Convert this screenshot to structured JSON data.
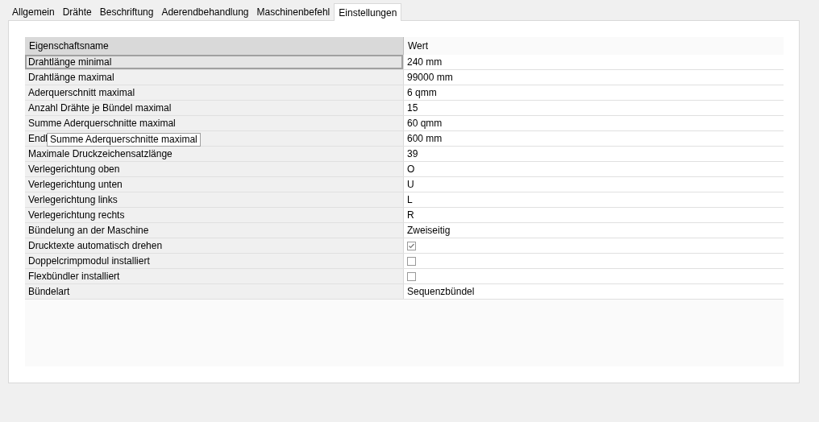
{
  "tabs": [
    {
      "label": "Allgemein",
      "selected": false
    },
    {
      "label": "Drähte",
      "selected": false
    },
    {
      "label": "Beschriftung",
      "selected": false
    },
    {
      "label": "Aderendbehandlung",
      "selected": false
    },
    {
      "label": "Maschinenbefehl",
      "selected": false
    },
    {
      "label": "Einstellungen",
      "selected": true
    }
  ],
  "grid": {
    "columns": [
      "Eigenschaftsname",
      "Wert"
    ],
    "rows": [
      {
        "name": "Drahtlänge minimal",
        "kind": "text",
        "value": "240 mm",
        "selected": true
      },
      {
        "name": "Drahtlänge maximal",
        "kind": "text",
        "value": "99000 mm",
        "selected": false
      },
      {
        "name": "Aderquerschnitt maximal",
        "kind": "text",
        "value": "6 qmm",
        "selected": false
      },
      {
        "name": "Anzahl Drähte je Bündel maximal",
        "kind": "text",
        "value": "15",
        "selected": false
      },
      {
        "name": "Summe Aderquerschnitte maximal",
        "kind": "text",
        "value": "60 qmm",
        "selected": false
      },
      {
        "name": "Endl",
        "kind": "text",
        "value": "600 mm",
        "selected": false
      },
      {
        "name": "Maximale Druckzeichensatzlänge",
        "kind": "text",
        "value": "39",
        "selected": false
      },
      {
        "name": "Verlegerichtung oben",
        "kind": "text",
        "value": "O",
        "selected": false
      },
      {
        "name": "Verlegerichtung unten",
        "kind": "text",
        "value": "U",
        "selected": false
      },
      {
        "name": "Verlegerichtung links",
        "kind": "text",
        "value": "L",
        "selected": false
      },
      {
        "name": "Verlegerichtung rechts",
        "kind": "text",
        "value": "R",
        "selected": false
      },
      {
        "name": "Bündelung an der Maschine",
        "kind": "text",
        "value": "Zweiseitig",
        "selected": false
      },
      {
        "name": "Drucktexte automatisch drehen",
        "kind": "checkbox",
        "checked": true,
        "selected": false
      },
      {
        "name": "Doppelcrimpmodul installiert",
        "kind": "checkbox",
        "checked": false,
        "selected": false
      },
      {
        "name": "Flexbündler installiert",
        "kind": "checkbox",
        "checked": false,
        "selected": false
      },
      {
        "name": "Bündelart",
        "kind": "text",
        "value": "Sequenzbündel",
        "selected": false
      }
    ]
  },
  "tooltip": {
    "text": "Summe Aderquerschnitte maximal"
  }
}
